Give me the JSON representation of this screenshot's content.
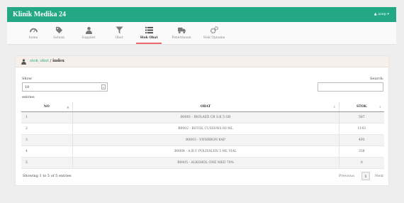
{
  "app": {
    "brand": "Klinik Medika 24",
    "user": "▲ asep ▾"
  },
  "nav": [
    {
      "id": "home",
      "label": "home",
      "icon": "dashboard-icon"
    },
    {
      "id": "satuan",
      "label": "Satuan",
      "icon": "tag-icon"
    },
    {
      "id": "supplier",
      "label": "Supplier",
      "icon": "user-icon"
    },
    {
      "id": "obat",
      "label": "Obat",
      "icon": "funnel-icon"
    },
    {
      "id": "stok-obat",
      "label": "Stok Obat",
      "icon": "list-icon",
      "active": true
    },
    {
      "id": "penerimaan",
      "label": "Penerimaan",
      "icon": "truck-icon"
    },
    {
      "id": "stok-opname",
      "label": "Stok Opname",
      "icon": "gears-icon"
    }
  ],
  "breadcrumb": {
    "link": "stok_obat",
    "sep": " / ",
    "current": "index"
  },
  "controls": {
    "show_label": "Show",
    "page_size": "10",
    "entries_label": "entries",
    "search_label": "Search:"
  },
  "table": {
    "headers": [
      "NO",
      "OBAT",
      "STOK"
    ],
    "rows": [
      {
        "no": "1",
        "obat": "B0001 - BIOLAEX CR S.K 5 GR",
        "stok": "587"
      },
      {
        "no": "2",
        "obat": "B0002 - BOTOL CUSSONS 60 ML",
        "stok": "1143"
      },
      {
        "no": "3",
        "obat": "B0003 - VIFERRON KAP",
        "stok": "493"
      },
      {
        "no": "4",
        "obat": "B0004 - A.B.U POLIVALEN 5 ML VIAL",
        "stok": "358"
      },
      {
        "no": "5",
        "obat": "B0005 - ALKOHOL ONE MED 70%",
        "stok": "0"
      }
    ]
  },
  "footer": {
    "info": "Showing 1 to 5 of 5 entries",
    "previous": "Previous",
    "page": "1",
    "next": "Next"
  },
  "colors": {
    "accent": "#22a885",
    "active_underline": "#ef6a6a"
  }
}
